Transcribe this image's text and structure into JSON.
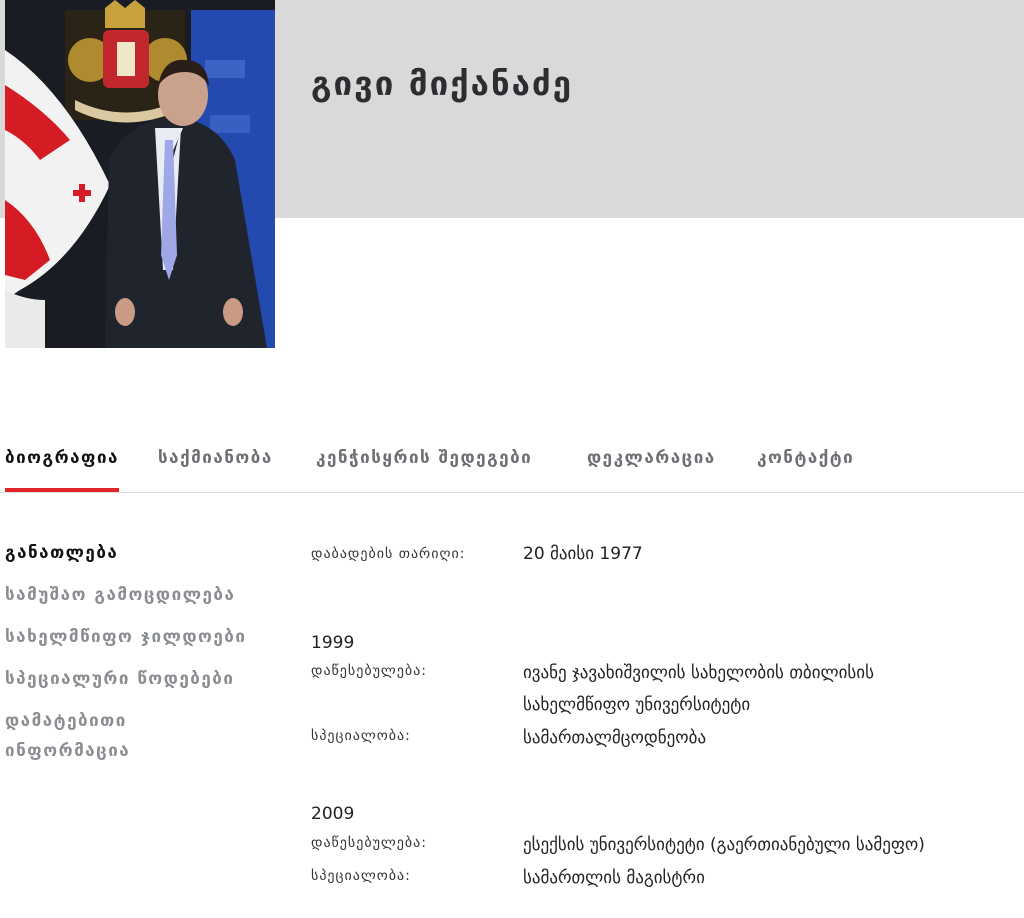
{
  "profile": {
    "name": "გივი მიქანაძე",
    "photo_alt": "Portrait photo"
  },
  "tabs": [
    {
      "label": "ბიოგრაფია",
      "active": true
    },
    {
      "label": "საქმიანობა",
      "active": false
    },
    {
      "label": "კენჭისყრის შედეგები",
      "active": false
    },
    {
      "label": "დეკლარაცია",
      "active": false
    },
    {
      "label": "კონტაქტი",
      "active": false
    }
  ],
  "side_nav": [
    {
      "label": "განათლება",
      "active": true
    },
    {
      "label": "სამუშაო გამოცდილება",
      "active": false
    },
    {
      "label": "სახელმწიფო ჯილდოები",
      "active": false
    },
    {
      "label": "სპეციალური წოდებები",
      "active": false
    },
    {
      "label": "დამატებითი",
      "active": false
    },
    {
      "label": "ინფორმაცია",
      "active": false
    }
  ],
  "birth": {
    "label": "დაბადების თარიღი:",
    "value": "20 მაისი 1977"
  },
  "education": [
    {
      "year": "1999",
      "institution_label": "დაწესებულება:",
      "institution_line1": "ივანე ჯავახიშვილის სახელობის თბილისის",
      "institution_line2": "სახელმწიფო უნივერსიტეტი",
      "specialty_label": "სპეციალობა:",
      "specialty": "სამართალმცოდნეობა"
    },
    {
      "year": "2009",
      "institution_label": "დაწესებულება:",
      "institution_line1": "ესექსის უნივერსიტეტი (გაერთიანებული სამეფო)",
      "specialty_label": "სპეციალობა:",
      "specialty": "სამართლის მაგისტრი"
    }
  ],
  "colors": {
    "accent": "#e0262b",
    "header_band": "#d9d9da"
  }
}
